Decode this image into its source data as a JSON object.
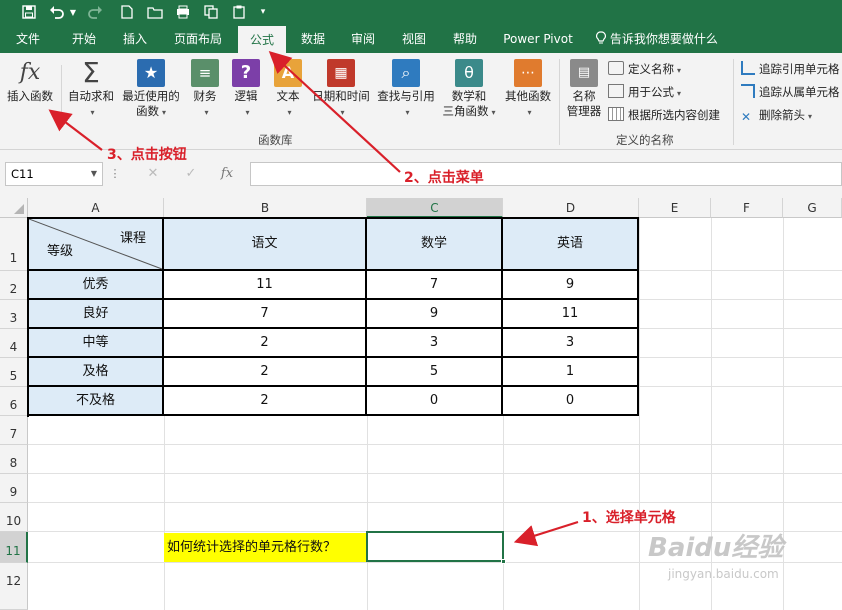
{
  "quick_access": {
    "save_icon": "save-icon",
    "undo_icon": "undo-icon",
    "redo_icon": "redo-icon"
  },
  "tabs": [
    "文件",
    "开始",
    "插入",
    "页面布局",
    "公式",
    "数据",
    "审阅",
    "视图",
    "帮助",
    "Power Pivot",
    "告诉我你想要做什么"
  ],
  "active_tab": "公式",
  "ribbon": {
    "function_library": {
      "insert_function": "插入函数",
      "autosum": "自动求和",
      "recent": [
        "最近使用的",
        "函数"
      ],
      "financial": "财务",
      "logical": "逻辑",
      "text": "文本",
      "datetime": "日期和时间",
      "lookup": "查找与引用",
      "math": [
        "数学和",
        "三角函数"
      ],
      "more": "其他函数",
      "group_label": "函数库"
    },
    "defined_names": {
      "name_manager": [
        "名称",
        "管理器"
      ],
      "define_name": "定义名称",
      "use_in_formula": "用于公式",
      "create_from_selection": "根据所选内容创建",
      "group_label": "定义的名称"
    },
    "formula_auditing": {
      "trace_precedents": "追踪引用单元格",
      "trace_dependents": "追踪从属单元格",
      "remove_arrows": "删除箭头"
    }
  },
  "formula_bar": {
    "name_box": "C11",
    "fx_label": "fx",
    "formula": ""
  },
  "columns": [
    "A",
    "B",
    "C",
    "D",
    "E",
    "F",
    "G"
  ],
  "rows": [
    "1",
    "2",
    "3",
    "4",
    "5",
    "6",
    "7",
    "8",
    "9",
    "10",
    "11",
    "12"
  ],
  "table": {
    "header_diag_top": "课程",
    "header_diag_bottom": "等级",
    "subjects": [
      "语文",
      "数学",
      "英语"
    ],
    "grades": [
      "优秀",
      "良好",
      "中等",
      "及格",
      "不及格"
    ],
    "values": [
      [
        11,
        7,
        9
      ],
      [
        7,
        9,
        11
      ],
      [
        2,
        3,
        3
      ],
      [
        2,
        5,
        1
      ],
      [
        2,
        0,
        0
      ]
    ]
  },
  "question": "如何统计选择的单元格行数？",
  "annotations": {
    "step1": "1、选择单元格",
    "step2": "2、点击菜单",
    "step3": "3、点击按钮"
  },
  "watermark": {
    "line1": "Baidu经验",
    "line2": "jingyan.baidu.com"
  },
  "colors": {
    "excel_green": "#217346",
    "arrow_red": "#d9202a",
    "header_blue": "#ddebf7",
    "question_yellow": "#ffff00"
  }
}
